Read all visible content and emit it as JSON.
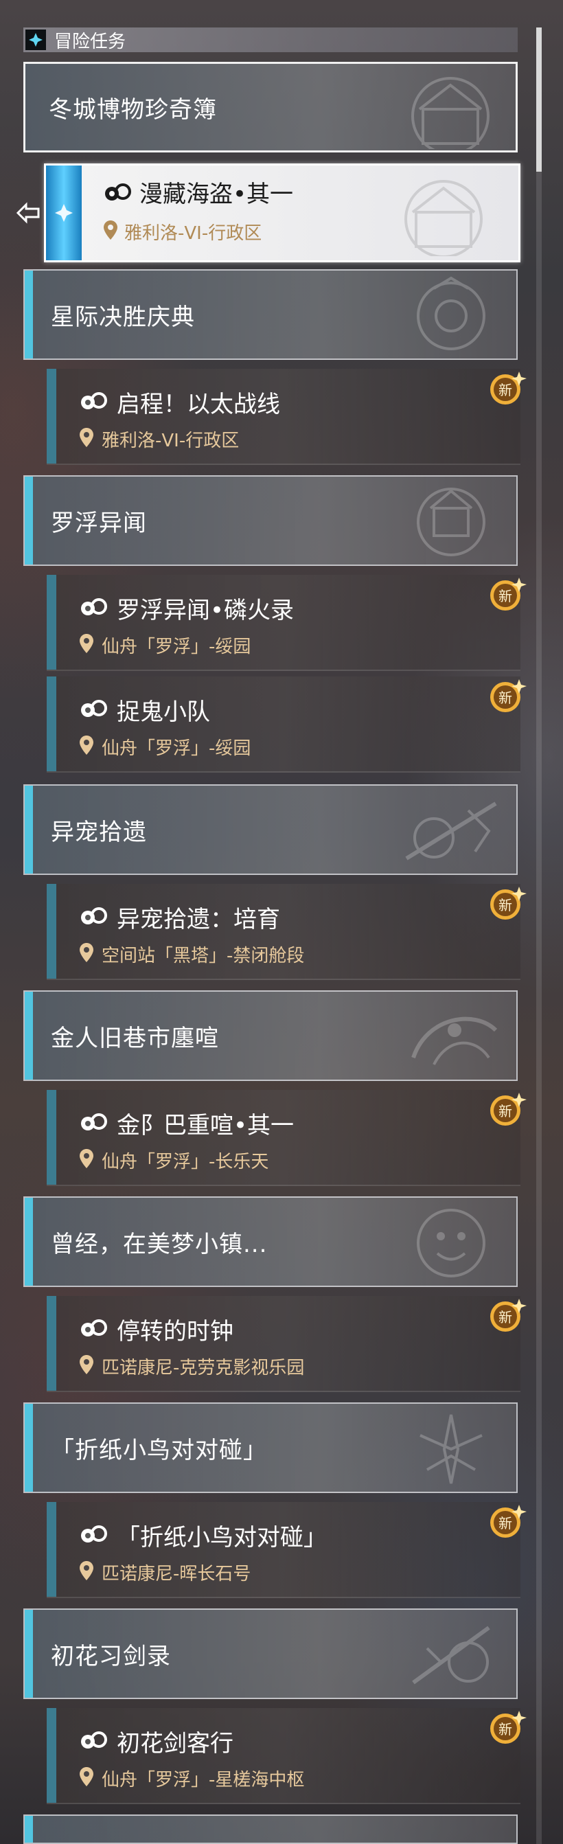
{
  "header": {
    "title": "冒险任务",
    "icon": "mission-diamond-icon"
  },
  "colors": {
    "accent": "#52c5e0",
    "selected_bar": "#5fd0ff",
    "location_text": "#e7c99c",
    "badge_gold": "#f0b03a"
  },
  "selected_mission": {
    "title": "漫藏海盗•其一",
    "location": "雅利洛-VI-行政区"
  },
  "groups": [
    {
      "title": "冬城博物珍奇簿"
    },
    {
      "title": "星际决胜庆典"
    },
    {
      "title": "罗浮异闻"
    },
    {
      "title": "异宠拾遗"
    },
    {
      "title": "金人旧巷市廛喧"
    },
    {
      "title": "曾经，在美梦小镇..."
    },
    {
      "title": "「折纸小鸟对对碰」"
    },
    {
      "title": "初花习剑录"
    }
  ],
  "missions": [
    {
      "title": "启程！以太战线",
      "location": "雅利洛-VI-行政区",
      "badge": "新"
    },
    {
      "title": "罗浮异闻•磷火录",
      "location": "仙舟「罗浮」-绥园",
      "badge": "新"
    },
    {
      "title": "捉鬼小队",
      "location": "仙舟「罗浮」-绥园",
      "badge": "新"
    },
    {
      "title": "异宠拾遗：培育",
      "location": "空间站「黑塔」-禁闭舱段",
      "badge": "新"
    },
    {
      "title": "金阝巴重喧•其一",
      "location": "仙舟「罗浮」-长乐天",
      "badge": "新"
    },
    {
      "title": "停转的时钟",
      "location": "匹诺康尼-克劳克影视乐园",
      "badge": "新"
    },
    {
      "title": "「折纸小鸟对对碰」",
      "location": "匹诺康尼-晖长石号",
      "badge": "新"
    },
    {
      "title": "初花剑客行",
      "location": "仙舟「罗浮」-星槎海中枢",
      "badge": "新"
    }
  ]
}
